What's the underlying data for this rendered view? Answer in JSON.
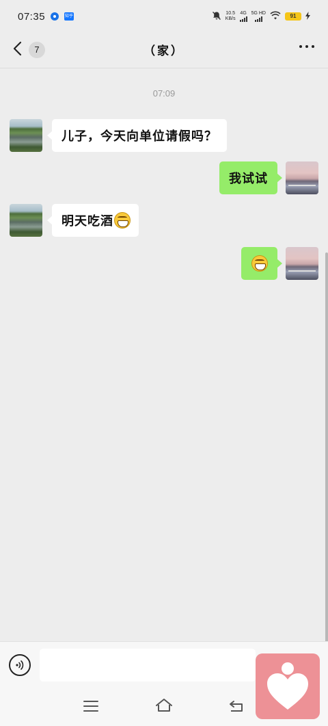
{
  "status_bar": {
    "time": "07:35",
    "zhihu_label": "知乎",
    "net_speed_value": "10.5",
    "net_speed_unit": "KB/s",
    "net_type_1": "4G",
    "net_type_2": "5G HD",
    "battery": "91",
    "icons": [
      "app-notification-icon",
      "zhihu-icon",
      "mute-bell-icon",
      "signal-icon",
      "wifi-icon",
      "battery-icon",
      "charging-bolt-icon"
    ]
  },
  "header": {
    "back_badge": "7",
    "title": "（家）"
  },
  "chat": {
    "timestamp": "07:09",
    "messages": [
      {
        "side": "left",
        "text": "儿子，今天向单位请假吗？",
        "emoji": ""
      },
      {
        "side": "right",
        "text": "我试试",
        "emoji": ""
      },
      {
        "side": "left",
        "text": "明天吃酒",
        "emoji": "grinning-face"
      },
      {
        "side": "right",
        "text": "",
        "emoji": "grinning-face"
      }
    ]
  },
  "input_bar": {
    "placeholder": ""
  },
  "colors": {
    "background": "#ededed",
    "sent_bubble": "#95ec69",
    "received_bubble": "#ffffff",
    "widget": "#ed9196"
  }
}
